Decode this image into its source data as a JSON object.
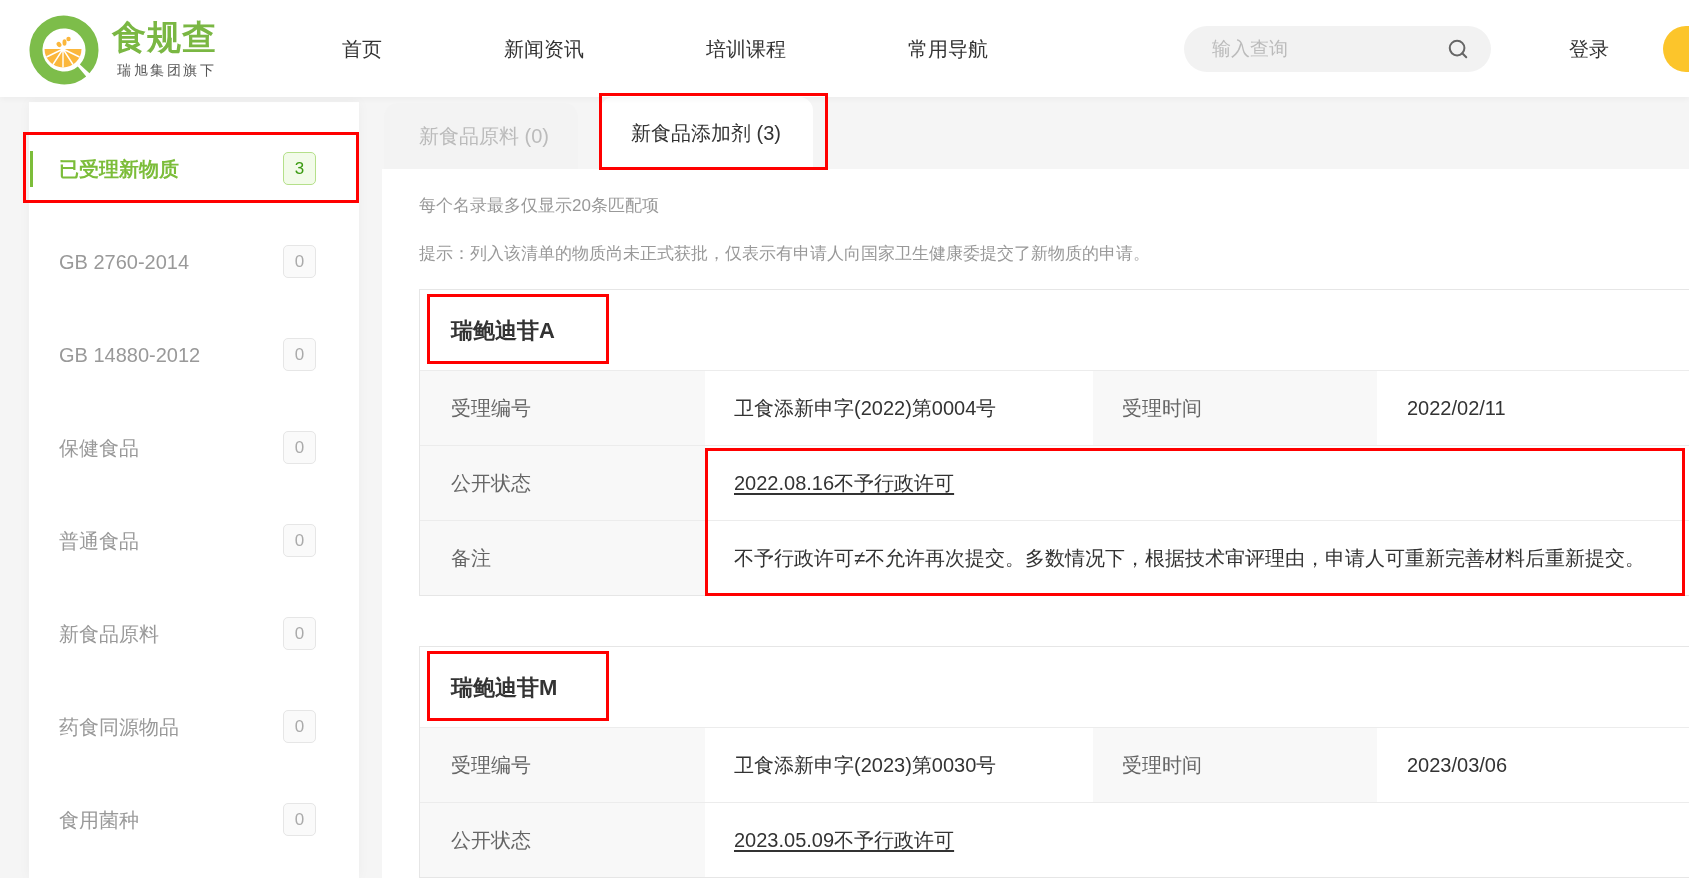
{
  "header": {
    "logo": {
      "name": "食规查",
      "tagline": "瑞旭集团旗下"
    },
    "nav": [
      {
        "label": "首页"
      },
      {
        "label": "新闻资讯"
      },
      {
        "label": "培训课程"
      },
      {
        "label": "常用导航"
      }
    ],
    "search": {
      "placeholder": "输入查询"
    },
    "login": "登录"
  },
  "sidebar": {
    "items": [
      {
        "label": "已受理新物质",
        "count": "3",
        "selected": true,
        "highlighted": true
      },
      {
        "label": "GB 2760-2014",
        "count": "0",
        "selected": false,
        "highlighted": false
      },
      {
        "label": "GB 14880-2012",
        "count": "0",
        "selected": false,
        "highlighted": false
      },
      {
        "label": "保健食品",
        "count": "0",
        "selected": false,
        "highlighted": false
      },
      {
        "label": "普通食品",
        "count": "0",
        "selected": false,
        "highlighted": false
      },
      {
        "label": "新食品原料",
        "count": "0",
        "selected": false,
        "highlighted": false
      },
      {
        "label": "药食同源物品",
        "count": "0",
        "selected": false,
        "highlighted": false
      },
      {
        "label": "食用菌种",
        "count": "0",
        "selected": false,
        "highlighted": false
      }
    ]
  },
  "tabs": [
    {
      "label": "新食品原料 (0)",
      "selected": false,
      "highlighted": false
    },
    {
      "label": "新食品添加剂 (3)",
      "selected": true,
      "highlighted": true
    }
  ],
  "notes": [
    "每个名录最多仅显示20条匹配项",
    "提示：列入该清单的物质尚未正式获批，仅表示有申请人向国家卫生健康委提交了新物质的申请。"
  ],
  "records": [
    {
      "title": {
        "text": "瑞鲍迪苷A",
        "highlighted": true
      },
      "rows": [
        {
          "highlighted": false,
          "fields": [
            {
              "label": "受理编号",
              "value": "卫食添新申字(2022)第0004号",
              "kind": "text"
            },
            {
              "label": "受理时间",
              "value": "2022/02/11",
              "kind": "text"
            }
          ]
        },
        {
          "highlighted": true,
          "fields": [
            {
              "label": "公开状态",
              "value": "2022.08.16不予行政许可",
              "kind": "link"
            }
          ]
        },
        {
          "highlighted": true,
          "fields": [
            {
              "label": "备注",
              "value": "不予行政许可≠不允许再次提交。多数情况下，根据技术审评理由，申请人可重新完善材料后重新提交。",
              "kind": "text"
            }
          ]
        }
      ]
    },
    {
      "title": {
        "text": "瑞鲍迪苷M",
        "highlighted": true
      },
      "rows": [
        {
          "highlighted": false,
          "fields": [
            {
              "label": "受理编号",
              "value": "卫食添新申字(2023)第0030号",
              "kind": "text"
            },
            {
              "label": "受理时间",
              "value": "2023/03/06",
              "kind": "text"
            }
          ]
        },
        {
          "highlighted": false,
          "fields": [
            {
              "label": "公开状态",
              "value": "2023.05.09不予行政许可",
              "kind": "link"
            }
          ]
        }
      ]
    }
  ]
}
